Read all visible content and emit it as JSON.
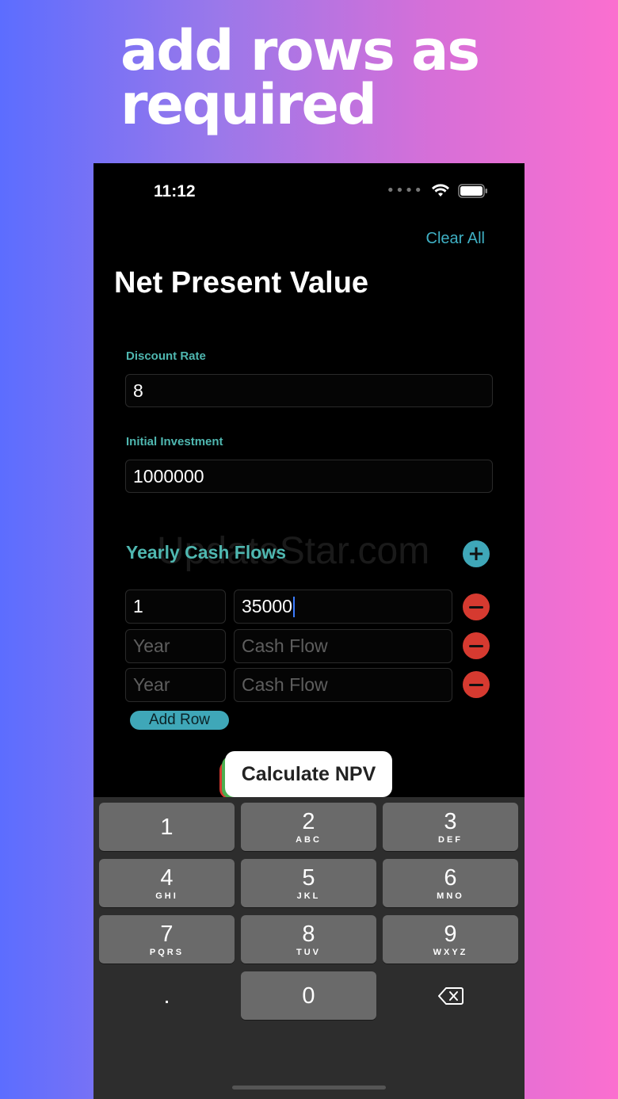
{
  "headline": {
    "line1": "add rows as",
    "line2": "required"
  },
  "status_bar": {
    "time": "11:12",
    "signal_icon": "signal-dots-icon",
    "wifi_icon": "wifi-icon",
    "battery_icon": "battery-icon"
  },
  "nav": {
    "clear_all": "Clear All"
  },
  "page": {
    "title": "Net Present Value"
  },
  "form": {
    "discount_rate": {
      "label": "Discount Rate",
      "value": "8"
    },
    "initial_investment": {
      "label": "Initial Investment",
      "value": "1000000"
    }
  },
  "cash_flows": {
    "title": "Yearly Cash Flows",
    "add_icon": "plus-circle-icon",
    "year_placeholder": "Year",
    "cash_placeholder": "Cash Flow",
    "rows": [
      {
        "year": "1",
        "cash": "35000"
      },
      {
        "year": "",
        "cash": ""
      },
      {
        "year": "",
        "cash": ""
      }
    ],
    "remove_icon": "minus-circle-icon",
    "add_row_label": "Add Row"
  },
  "calculate_label": "Calculate NPV",
  "watermark": "UpdateStar.com",
  "keyboard": {
    "keys": [
      {
        "num": "1",
        "letters": ""
      },
      {
        "num": "2",
        "letters": "ABC"
      },
      {
        "num": "3",
        "letters": "DEF"
      },
      {
        "num": "4",
        "letters": "GHI"
      },
      {
        "num": "5",
        "letters": "JKL"
      },
      {
        "num": "6",
        "letters": "MNO"
      },
      {
        "num": "7",
        "letters": "PQRS"
      },
      {
        "num": "8",
        "letters": "TUV"
      },
      {
        "num": "9",
        "letters": "WXYZ"
      },
      {
        "num": ".",
        "letters": ""
      },
      {
        "num": "0",
        "letters": ""
      }
    ],
    "backspace_icon": "backspace-icon"
  },
  "colors": {
    "accent": "#3fa7b8",
    "danger": "#d63a30",
    "label": "#4fb7b0"
  }
}
